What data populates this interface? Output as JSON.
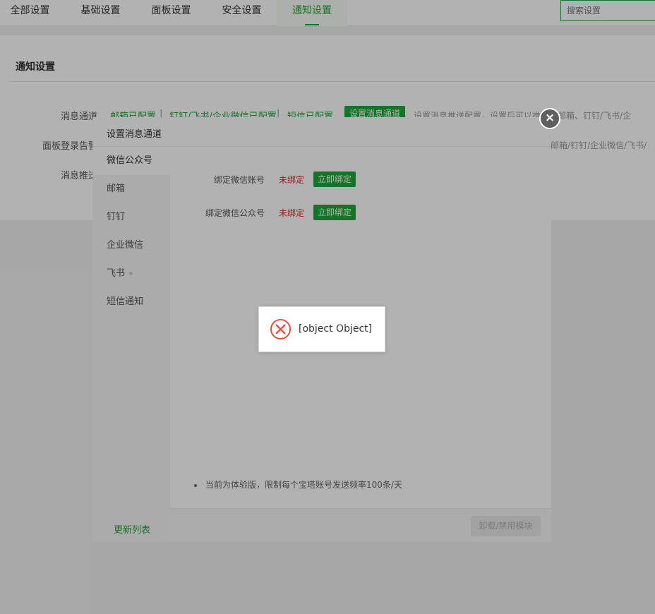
{
  "tabs": [
    "全部设置",
    "基础设置",
    "面板设置",
    "安全设置",
    "通知设置"
  ],
  "search": {
    "placeholder": "搜索设置"
  },
  "section": {
    "title": "通知设置",
    "channel_label": "消息通道",
    "channels": [
      "邮箱已配置",
      "钉钉/飞书/企业微信已配置",
      "短信已配置"
    ],
    "separator": "|",
    "channel_button": "设置消息通道",
    "channel_hint": "设置消息推送配置，设置后可以推送至邮箱、钉钉/飞书/企",
    "login_alert_label": "面板登录告警",
    "login_alert_hint": "/邮箱/钉钉/企业微信/飞书/",
    "push_label": "消息推送"
  },
  "dialog": {
    "title": "设置消息通道",
    "menu": [
      "微信公众号",
      "邮箱",
      "钉钉",
      "企业微信",
      "飞书",
      "短信通知"
    ],
    "update_list": "更新列表",
    "bindings": [
      {
        "label": "绑定微信账号",
        "status": "未绑定",
        "button": "立即绑定"
      },
      {
        "label": "绑定微信公众号",
        "status": "未绑定",
        "button": "立即绑定"
      }
    ],
    "note": "当前为体验版，限制每个宝塔账号发送频率100条/天",
    "footer_button": "卸载/禁用模块"
  },
  "toast": {
    "message": "[object Object]"
  },
  "colors": {
    "accent": "#20a53a",
    "error": "#d9262b"
  }
}
